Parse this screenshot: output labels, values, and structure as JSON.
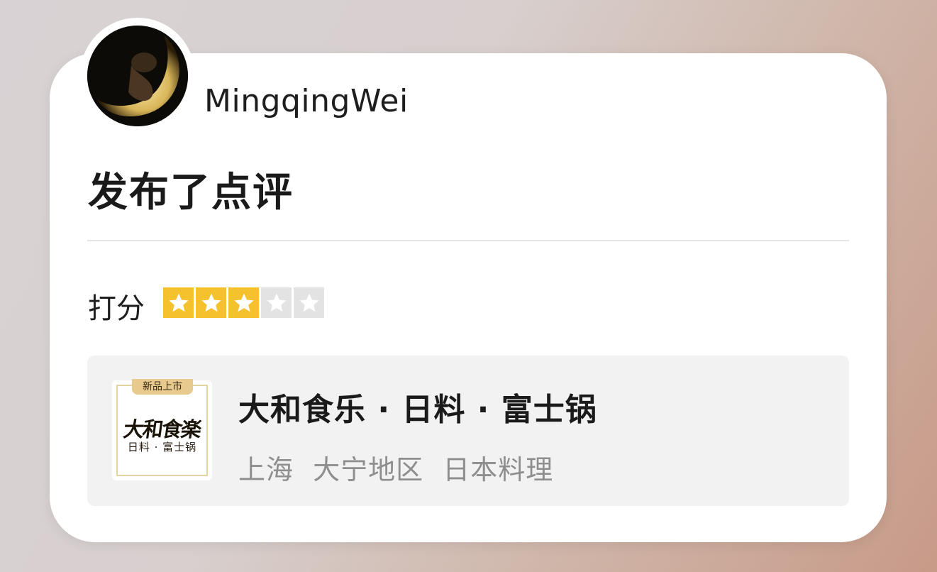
{
  "user": {
    "name": "MingqingWei",
    "avatar_icon": "crescent-moon-avatar"
  },
  "post": {
    "action": "发布了点评"
  },
  "rating": {
    "label": "打分",
    "value": 3,
    "max": 5,
    "filled_color": "#f5c12c",
    "empty_color": "#e3e3e3"
  },
  "shop": {
    "name": "大和食乐 · 日料 · 富士锅",
    "city": "上海",
    "district": "大宁地区",
    "category": "日本料理",
    "logo": {
      "badge": "新品上市",
      "main_text": "大和食楽",
      "sub_text": "日料 · 富士锅"
    }
  }
}
